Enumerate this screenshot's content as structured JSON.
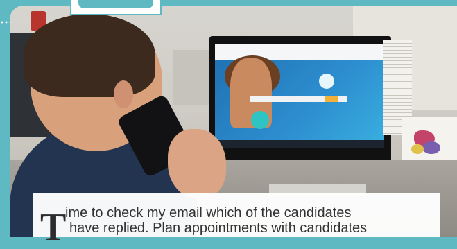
{
  "caption": {
    "drop_cap": "T",
    "line1": "ime to check my email which of the candidates",
    "line2": "have replied. Plan appointments with candidates"
  },
  "colors": {
    "frame": "#5fb9c2",
    "caption_bg": "#ffffff",
    "caption_text": "#333333"
  }
}
